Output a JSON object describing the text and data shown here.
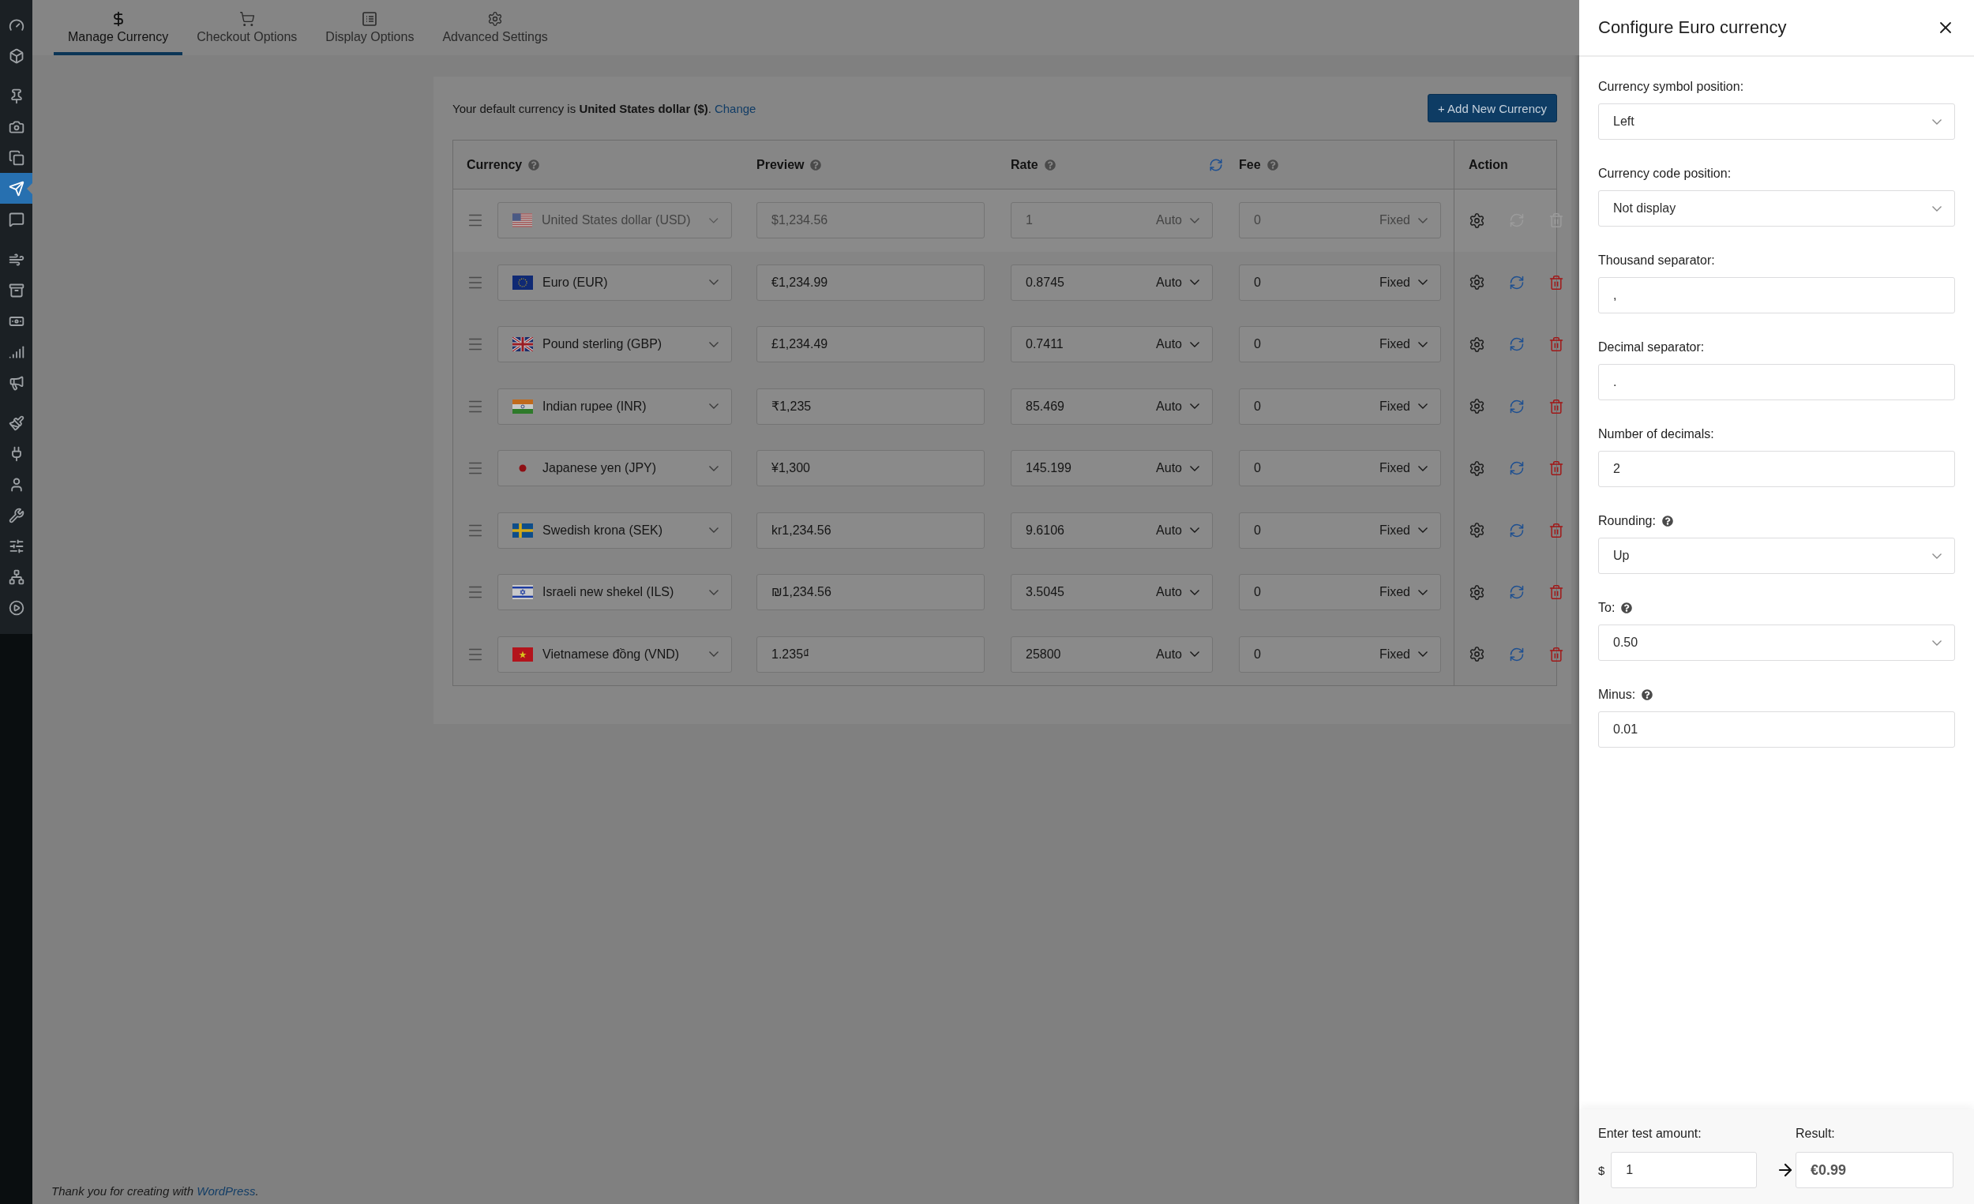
{
  "admin_menu": [
    {
      "selected": false
    },
    {
      "selected": false
    },
    {
      "selected": false
    },
    {
      "selected": false
    },
    {
      "selected": false
    },
    {
      "selected": true
    },
    {
      "selected": false
    },
    {
      "selected": false
    },
    {
      "selected": false
    },
    {
      "selected": false
    },
    {
      "selected": false
    },
    {
      "selected": false
    },
    {
      "selected": false
    },
    {
      "selected": false
    },
    {
      "selected": false
    },
    {
      "selected": false
    },
    {
      "selected": false
    },
    {
      "selected": false
    },
    {
      "selected": false
    }
  ],
  "tabs": [
    {
      "label": "Manage Currency",
      "kind": "dollar",
      "selected": true
    },
    {
      "label": "Checkout Options",
      "kind": "cart",
      "selected": false
    },
    {
      "label": "Display Options",
      "kind": "list",
      "selected": false
    },
    {
      "label": "Advanced Settings",
      "kind": "gear",
      "selected": false
    }
  ],
  "notice": {
    "text": "Your default currency is **United States dollar ($)**.",
    "link": "Change"
  },
  "add_button": "+ Add New Currency",
  "table": {
    "columns": [
      {
        "label": "Currency",
        "help": true,
        "refresh": false
      },
      {
        "label": "Preview",
        "help": true,
        "refresh": false
      },
      {
        "label": "Rate",
        "help": true,
        "refresh": true
      },
      {
        "label": "Fee",
        "help": true,
        "refresh": false
      },
      {
        "label": "Action",
        "help": false,
        "refresh": false
      }
    ],
    "rows": [
      {
        "kind": "us",
        "currency": "United States dollar (USD)",
        "preview": "$1,234.56",
        "rate": "1",
        "rate_mode": "Auto",
        "fee": "0",
        "fee_mode": "Fixed",
        "disabled": true
      },
      {
        "kind": "eu",
        "currency": "Euro (EUR)",
        "preview": "€1,234.99",
        "rate": "0.8745",
        "rate_mode": "Auto",
        "fee": "0",
        "fee_mode": "Fixed",
        "disabled": false
      },
      {
        "kind": "gb",
        "currency": "Pound sterling (GBP)",
        "preview": "£1,234.49",
        "rate": "0.7411",
        "rate_mode": "Auto",
        "fee": "0",
        "fee_mode": "Fixed",
        "disabled": false
      },
      {
        "kind": "in",
        "currency": "Indian rupee (INR)",
        "preview": "₹1,235",
        "rate": "85.469",
        "rate_mode": "Auto",
        "fee": "0",
        "fee_mode": "Fixed",
        "disabled": false
      },
      {
        "kind": "jp",
        "currency": "Japanese yen (JPY)",
        "preview": "¥1,300",
        "rate": "145.199",
        "rate_mode": "Auto",
        "fee": "0",
        "fee_mode": "Fixed",
        "disabled": false
      },
      {
        "kind": "se",
        "currency": "Swedish krona (SEK)",
        "preview": "kr1,234.56",
        "rate": "9.6106",
        "rate_mode": "Auto",
        "fee": "0",
        "fee_mode": "Fixed",
        "disabled": false
      },
      {
        "kind": "il",
        "currency": "Israeli new shekel (ILS)",
        "preview": "₪1,234.56",
        "rate": "3.5045",
        "rate_mode": "Auto",
        "fee": "0",
        "fee_mode": "Fixed",
        "disabled": false
      },
      {
        "kind": "vn",
        "currency": "Vietnamese đồng (VND)",
        "preview": "1.235₫",
        "rate": "25800",
        "rate_mode": "Auto",
        "fee": "0",
        "fee_mode": "Fixed",
        "disabled": false
      }
    ]
  },
  "footer": {
    "before": "Thank you for creating with",
    "link": "WordPress",
    "after": "."
  },
  "panel": {
    "title": "Configure Euro currency",
    "fields": [
      {
        "label": "Currency symbol position:",
        "help": false,
        "kind": "select",
        "value": "Left"
      },
      {
        "label": "Currency code position:",
        "help": false,
        "kind": "select",
        "value": "Not display"
      },
      {
        "label": "Thousand separator:",
        "help": false,
        "kind": "input",
        "value": ","
      },
      {
        "label": "Decimal separator:",
        "help": false,
        "kind": "input",
        "value": "."
      },
      {
        "label": "Number of decimals:",
        "help": false,
        "kind": "input",
        "value": "2"
      },
      {
        "label": "Rounding:",
        "help": true,
        "kind": "select",
        "value": "Up"
      },
      {
        "label": "To:",
        "help": true,
        "kind": "select",
        "value": "0.50"
      },
      {
        "label": "Minus:",
        "help": true,
        "kind": "input",
        "value": "0.01"
      }
    ],
    "test": {
      "amount_label": "Enter test amount:",
      "symbol": "$",
      "amount": "1",
      "result_label": "Result:",
      "result": "€0.99"
    }
  }
}
